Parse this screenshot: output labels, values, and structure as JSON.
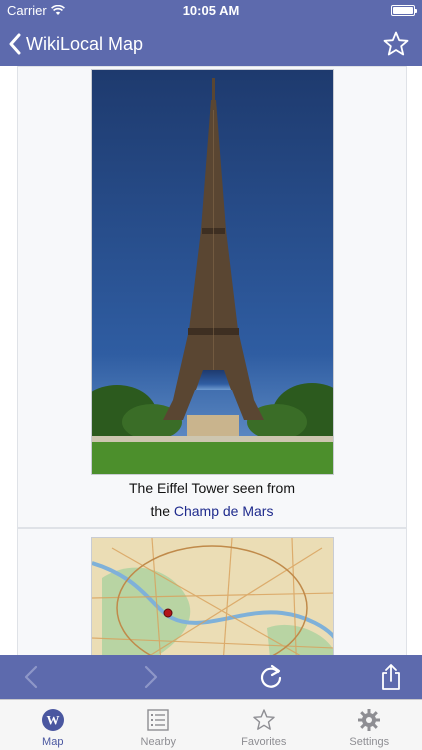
{
  "status_bar": {
    "carrier": "Carrier",
    "time": "10:05 AM"
  },
  "nav": {
    "back_title": "WikiLocal Map"
  },
  "article": {
    "caption_line1": "The Eiffel Tower seen from",
    "caption_prefix": "the",
    "caption_link": "Champ de Mars"
  },
  "tabs": [
    {
      "label": "Map",
      "icon": "wikipedia-icon",
      "active": true
    },
    {
      "label": "Nearby",
      "icon": "list-icon",
      "active": false
    },
    {
      "label": "Favorites",
      "icon": "star-icon",
      "active": false
    },
    {
      "label": "Settings",
      "icon": "gear-icon",
      "active": false
    }
  ],
  "colors": {
    "bar": "#5d6aad",
    "active_tab": "#4a57a0",
    "link": "#1f2b8d"
  }
}
